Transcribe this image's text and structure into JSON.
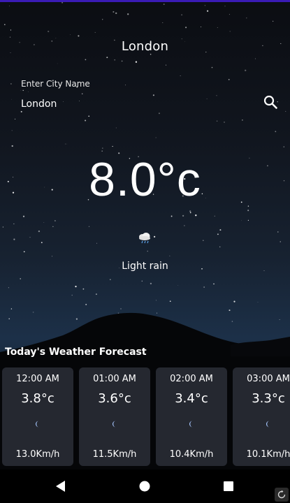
{
  "header": {
    "city": "London"
  },
  "search": {
    "label": "Enter City Name",
    "value": "London",
    "icon": "search-icon"
  },
  "current": {
    "temperature": "8.0°c",
    "condition": "Light rain",
    "icon": "light-rain-icon"
  },
  "forecast": {
    "title": "Today's Weather Forecast",
    "items": [
      {
        "time": "12:00 AM",
        "temp": "3.8°c",
        "icon": "moon-icon",
        "wind": "13.0Km/h"
      },
      {
        "time": "01:00 AM",
        "temp": "3.6°c",
        "icon": "moon-icon",
        "wind": "11.5Km/h"
      },
      {
        "time": "02:00 AM",
        "temp": "3.4°c",
        "icon": "moon-icon",
        "wind": "10.4Km/h"
      },
      {
        "time": "03:00 AM",
        "temp": "3.3°c",
        "icon": "moon-icon",
        "wind": "10.1Km/h"
      }
    ]
  },
  "navigation": {
    "back": "back-icon",
    "home": "home-icon",
    "recents": "recents-icon",
    "rotate": "rotate-icon"
  },
  "colors": {
    "status_bar": "#3a1bb5",
    "card_background": "#282b34",
    "text": "#ffffff"
  }
}
